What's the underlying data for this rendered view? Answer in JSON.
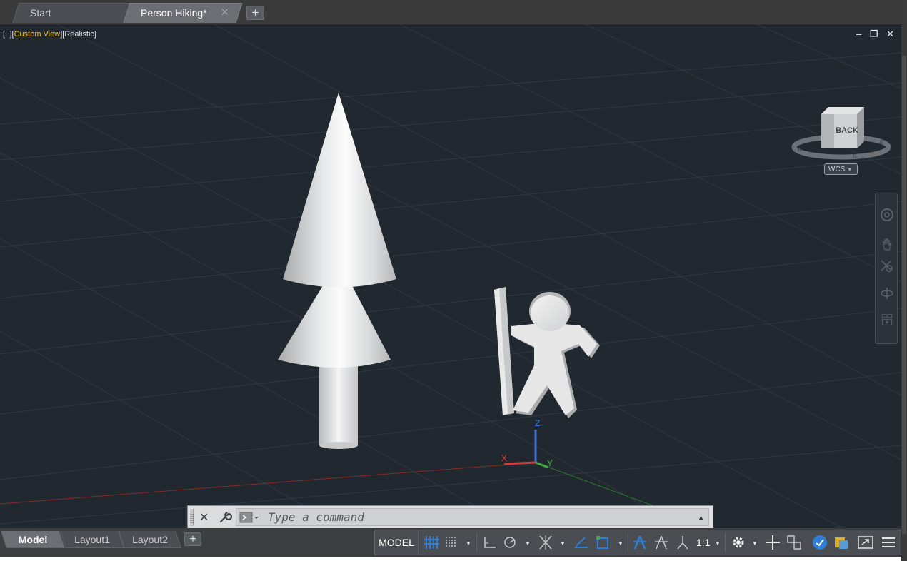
{
  "doc_tabs": {
    "start_label": "Start",
    "active_label": "Person Hiking*",
    "close_glyph": "✕",
    "add_glyph": "+"
  },
  "viewport": {
    "controls_prefix": "[−][",
    "view_name": "Custom View",
    "controls_middle": "][",
    "visual_style": "Realistic",
    "controls_suffix": "]",
    "window_buttons": [
      "‒",
      "❐",
      "✕"
    ],
    "viewcube_face": "BACK",
    "compass_letters": [
      "S",
      "N",
      "W",
      "E"
    ],
    "wcs_label": "WCS",
    "ucs_labels": {
      "x": "X",
      "y": "Y",
      "z": "Z"
    }
  },
  "command_line": {
    "placeholder": "Type a command",
    "close_glyph": "✕",
    "history_glyph": "▲"
  },
  "layout_tabs": {
    "tabs": [
      "Model",
      "Layout1",
      "Layout2"
    ],
    "active": "Model",
    "add_glyph": "+"
  },
  "status_bar": {
    "space_label": "MODEL",
    "scale_label": "1:1",
    "drop_glyph": "▼"
  },
  "colors": {
    "viewport_bg": "#212830",
    "accent_yellow": "#f5c400",
    "status_blue": "#2f7fd8",
    "axis_x": "#d43c3c",
    "axis_y": "#3cb03c",
    "axis_z": "#3c6fd8"
  }
}
